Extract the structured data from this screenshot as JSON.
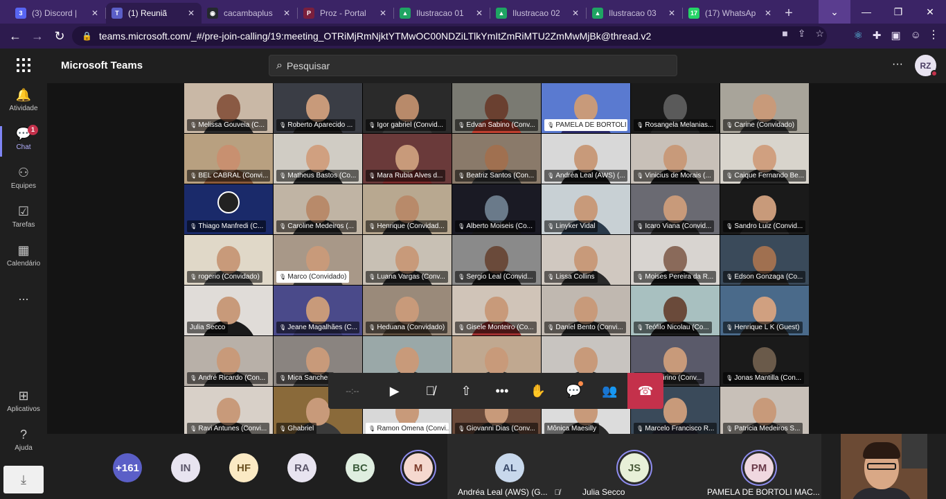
{
  "browser": {
    "tabs": [
      {
        "label": "(3) Discord | ",
        "favicon_color": "#5865F2",
        "favicon_text": "3"
      },
      {
        "label": "(1) Reuniã",
        "favicon_color": "#5b5fc7",
        "favicon_text": "T",
        "active": true
      },
      {
        "label": "cacambaplus",
        "favicon_color": "#24292e",
        "favicon_text": "◉"
      },
      {
        "label": "Proz - Portal",
        "favicon_color": "#7a1f3d",
        "favicon_text": "P"
      },
      {
        "label": "Ilustracao 01",
        "favicon_color": "#1fa463",
        "favicon_text": "▲"
      },
      {
        "label": "Ilustracao 02",
        "favicon_color": "#1fa463",
        "favicon_text": "▲"
      },
      {
        "label": "Ilustracao 03",
        "favicon_color": "#1fa463",
        "favicon_text": "▲"
      },
      {
        "label": "(17) WhatsAp",
        "favicon_color": "#25d366",
        "favicon_text": "17"
      }
    ],
    "url": "teams.microsoft.com/_#/pre-join-calling/19:meeting_OTRiMjRmNjktYTMwOC00NDZiLTlkYmItZmRiMTU2ZmMwMjBk@thread.v2"
  },
  "teams": {
    "app_title": "Microsoft Teams",
    "search_placeholder": "Pesquisar",
    "user_initials": "RZ",
    "rail": [
      {
        "label": "Atividade",
        "icon": "bell-icon"
      },
      {
        "label": "Chat",
        "icon": "chat-icon",
        "badge": "1",
        "active": true
      },
      {
        "label": "Equipes",
        "icon": "teams-icon"
      },
      {
        "label": "Tarefas",
        "icon": "tasks-icon"
      },
      {
        "label": "Calendário",
        "icon": "calendar-icon"
      },
      {
        "label": "...",
        "icon": "more-icon"
      },
      {
        "label": "Aplicativos",
        "icon": "apps-icon"
      },
      {
        "label": "Ajuda",
        "icon": "help-icon"
      }
    ]
  },
  "call": {
    "timer": "--:--",
    "participants": [
      {
        "name": "Melissa Gouveia (C...",
        "bg": "#c9b8a6",
        "skin": "#8a5a44",
        "shirt": "#2a2a2a"
      },
      {
        "name": "Roberto Aparecido ...",
        "bg": "#3a3d45",
        "skin": "#c89a7a",
        "shirt": "#1a1a1a"
      },
      {
        "name": "Igor gabriel (Convid...",
        "bg": "#2a2a2a",
        "skin": "#b88a6a",
        "shirt": "#3a3a3a"
      },
      {
        "name": "Edvan Sabino (Conv...",
        "bg": "#7a7a72",
        "skin": "#6a4030",
        "shirt": "#c04030"
      },
      {
        "name": "PAMELA DE BORTOLI ...",
        "bg": "#5a7ad0",
        "skin": "#c89a7a",
        "shirt": "#2a2a6a",
        "light": true
      },
      {
        "name": "Rosangela Melanias...",
        "bg": "#1a1a1a",
        "skin": "#5a5a5a",
        "shirt": "#2a2a2a"
      },
      {
        "name": "Carine (Convidado)",
        "bg": "#a8a49a",
        "skin": "#c89a7a",
        "shirt": "#3a3a3a"
      },
      {
        "name": "BEL CABRAL (Convi...",
        "bg": "#b8a080",
        "skin": "#c89070",
        "shirt": "#8a5a3a"
      },
      {
        "name": "Matheus Bastos (Co...",
        "bg": "#d0ccc4",
        "skin": "#d0a080",
        "shirt": "#2a2a2a"
      },
      {
        "name": "Mara Rubia Alves d...",
        "bg": "#6a3a3a",
        "skin": "#c89a7a",
        "shirt": "#7a2a2a"
      },
      {
        "name": "Beatriz Santos (Con...",
        "bg": "#8a7a6a",
        "skin": "#a07050",
        "shirt": "#3a3a3a"
      },
      {
        "name": "Andréa Leal (AWS) (...",
        "bg": "#d8d8d8",
        "skin": "#c89a7a",
        "shirt": "#1a1a1a"
      },
      {
        "name": "Vinicius de Morais (...",
        "bg": "#c8c0b8",
        "skin": "#c89a7a",
        "shirt": "#1a1a1a"
      },
      {
        "name": "Caique Fernando Be...",
        "bg": "#d8d4cc",
        "skin": "#d0a080",
        "shirt": "#2a2a2a"
      },
      {
        "name": "Thiago Manfredi (C...",
        "bg": "#1a2a6a",
        "obs": true
      },
      {
        "name": "Caroline Medeiros (...",
        "bg": "#c0b4a4",
        "skin": "#b88a6a",
        "shirt": "#2a2a2a"
      },
      {
        "name": "Henrique (Convidad...",
        "bg": "#b8a890",
        "skin": "#b88a6a",
        "shirt": "#2a2a2a"
      },
      {
        "name": "Alberto Moiseis (Co...",
        "bg": "#1a1a24",
        "skin": "#6a7a8a",
        "shirt": "#1a1a1a"
      },
      {
        "name": "Linyker Vidal",
        "bg": "#c8d0d4",
        "skin": "#c89a7a",
        "shirt": "#2a3a4a"
      },
      {
        "name": "Icaro Viana (Convid...",
        "bg": "#6a6a72",
        "skin": "#c89a7a",
        "shirt": "#2a2a2a"
      },
      {
        "name": "Sandro Luiz (Convid...",
        "bg": "#1a1a1a",
        "skin": "#c89a7a",
        "shirt": "#2a2a2a"
      },
      {
        "name": "rogerio (Convidado)",
        "bg": "#e0d8c8",
        "skin": "#c89a7a",
        "shirt": "#4a4a4a"
      },
      {
        "name": "Marco (Convidado)",
        "bg": "#a89888",
        "skin": "#c89a7a",
        "shirt": "#3a3a3a",
        "light": true
      },
      {
        "name": "Luana Vargas (Conv...",
        "bg": "#c8c0b4",
        "skin": "#c89a7a",
        "shirt": "#2a2a2a"
      },
      {
        "name": "Sergio Leal (Convid...",
        "bg": "#8a8a8a",
        "skin": "#6a4a3a",
        "shirt": "#1a1a1a"
      },
      {
        "name": "Lissa Collins",
        "bg": "#d0c8c0",
        "skin": "#c89a7a",
        "shirt": "#2a2a2a"
      },
      {
        "name": "Moises Pereira da R...",
        "bg": "#d8d4d0",
        "skin": "#8a6a5a",
        "shirt": "#1a1a1a"
      },
      {
        "name": "Edson Gonzaga (Co...",
        "bg": "#3a4a5a",
        "skin": "#a07050",
        "shirt": "#2a2a2a"
      },
      {
        "name": "Julia Secco",
        "bg": "#e0dcd8",
        "skin": "#c89a7a",
        "shirt": "#1a1a1a",
        "nomic": true
      },
      {
        "name": "Jeane Magalhães (C...",
        "bg": "#4a4a8a",
        "skin": "#c89a7a",
        "shirt": "#3a3a6a"
      },
      {
        "name": "Heduana (Convidado)",
        "bg": "#9a8a7a",
        "skin": "#c89a7a",
        "shirt": "#5a4a3a"
      },
      {
        "name": "Gisele Monteiro (Co...",
        "bg": "#d0c4b8",
        "skin": "#c89a7a",
        "shirt": "#a03030"
      },
      {
        "name": "Daniel Bento (Convi...",
        "bg": "#c0b8b0",
        "skin": "#c89a7a",
        "shirt": "#2a2a2a"
      },
      {
        "name": "Teófilo Nicolau (Co...",
        "bg": "#a8c0c0",
        "skin": "#6a4a3a",
        "shirt": "#1a1a1a"
      },
      {
        "name": "Henrique L K (Guest)",
        "bg": "#4a6a8a",
        "skin": "#d0a080",
        "shirt": "#2a2a2a"
      },
      {
        "name": "André Ricardo (Con...",
        "bg": "#b8b0a8",
        "skin": "#c89a7a",
        "shirt": "#2a2a2a"
      },
      {
        "name": "Mica Sanches",
        "bg": "#8a8480",
        "skin": "#c89a7a",
        "shirt": "#3a3a3a"
      },
      {
        "name": "",
        "bg": "#9aa8a8",
        "skin": "#c89a7a",
        "shirt": "#2a2a2a"
      },
      {
        "name": "",
        "bg": "#c0a890",
        "skin": "#c89a7a",
        "shirt": "#2a2a2a"
      },
      {
        "name": "",
        "bg": "#c8c4c0",
        "skin": "#c89a7a",
        "shirt": "#2a2a2a"
      },
      {
        "name": "...la Cirino (Conv...",
        "bg": "#5a5a6a",
        "skin": "#c89a7a",
        "shirt": "#2a2a2a"
      },
      {
        "name": "Jonas Mantilla (Con...",
        "bg": "#1a1a1a",
        "skin": "#6a5a4a",
        "shirt": "#1a1a1a"
      },
      {
        "name": "Ravi Antunes (Convi...",
        "bg": "#d8d0c8",
        "skin": "#c89a7a",
        "shirt": "#2a2a2a"
      },
      {
        "name": "Ghabriel",
        "bg": "#8a6a3a",
        "skin": "#c89a7a",
        "shirt": "#3a3a3a"
      },
      {
        "name": "Ramon Omena (Convi...",
        "bg": "#d8d8d8",
        "skin": "#c89a7a",
        "shirt": "#1a1a1a",
        "light": true
      },
      {
        "name": "Giovanni Dias (Conv...",
        "bg": "#6a4a3a",
        "skin": "#c89a7a",
        "shirt": "#2a2a2a"
      },
      {
        "name": "Mônica Maesilly",
        "bg": "#dcdcdc",
        "skin": "#c89a7a",
        "shirt": "#2a2a2a",
        "nomic": true
      },
      {
        "name": "Marcelo Francisco R...",
        "bg": "#3a4a5a",
        "skin": "#c89a7a",
        "shirt": "#2a2a3a"
      },
      {
        "name": "Patricia Medeiros S...",
        "bg": "#c8c0b8",
        "skin": "#c89a7a",
        "shirt": "#3a3a3a"
      }
    ],
    "roster": [
      {
        "text": "+161",
        "bg": "#5b5fc7",
        "fg": "#ffffff"
      },
      {
        "text": "IN",
        "bg": "#e8e4f0",
        "fg": "#5a5568"
      },
      {
        "text": "HF",
        "bg": "#fbeac4",
        "fg": "#6a5020"
      },
      {
        "text": "RA",
        "bg": "#e8e4f0",
        "fg": "#5a5568"
      },
      {
        "text": "BC",
        "bg": "#dfeee0",
        "fg": "#3a5a3a"
      },
      {
        "text": "M",
        "bg": "#f5d8cf",
        "fg": "#7a3a2a",
        "ring": true
      }
    ],
    "focus": [
      {
        "initials": "AL",
        "name": "Andréa Leal (AWS) (G...",
        "bg": "#c8d8ec",
        "fg": "#3a4a6a",
        "muted": true
      },
      {
        "initials": "JS",
        "name": "Julia Secco",
        "bg": "#e8f0d8",
        "fg": "#4a5a3a",
        "ring": true
      },
      {
        "initials": "PM",
        "name": "PAMELA DE BORTOLI MAC...",
        "bg": "#f0d8e0",
        "fg": "#6a3a4a",
        "ring": true
      }
    ]
  }
}
